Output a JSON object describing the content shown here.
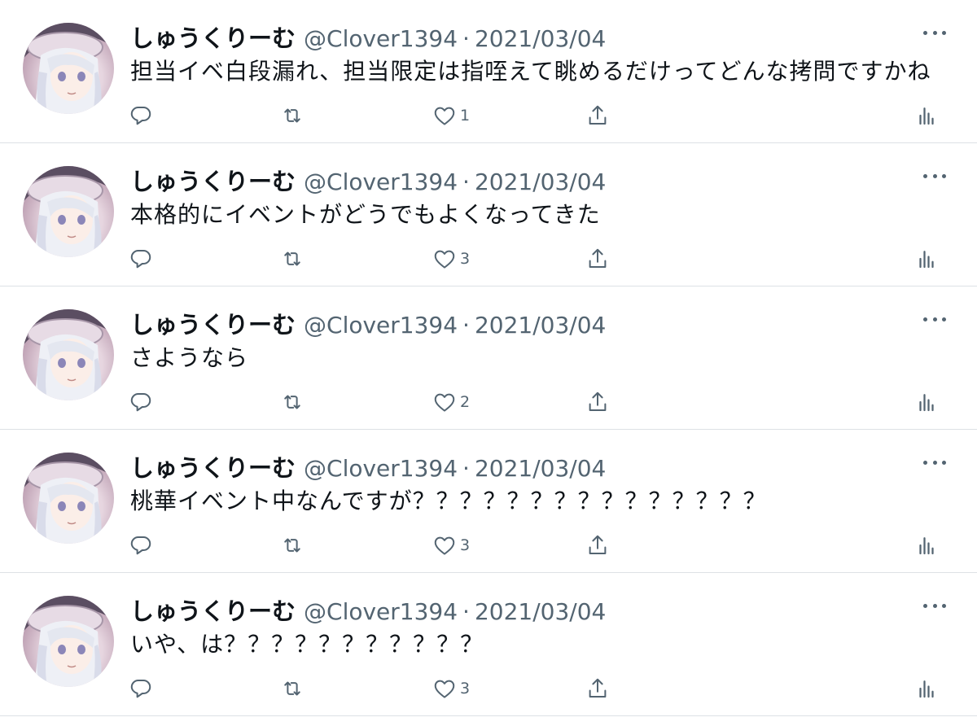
{
  "tweets": [
    {
      "name": "しゅうくりーむ",
      "handle": "@Clover1394",
      "separator": "·",
      "date": "2021/03/04",
      "text": "担当イベ白段漏れ、担当限定は指咥えて眺めるだけってどんな拷問ですかね",
      "likes": "1"
    },
    {
      "name": "しゅうくりーむ",
      "handle": "@Clover1394",
      "separator": "·",
      "date": "2021/03/04",
      "text": "本格的にイベントがどうでもよくなってきた",
      "likes": "3"
    },
    {
      "name": "しゅうくりーむ",
      "handle": "@Clover1394",
      "separator": "·",
      "date": "2021/03/04",
      "text": "さようなら",
      "likes": "2"
    },
    {
      "name": "しゅうくりーむ",
      "handle": "@Clover1394",
      "separator": "·",
      "date": "2021/03/04",
      "text": "桃華イベント中なんですが？？？？？？？？？？？？？？？",
      "likes": "3"
    },
    {
      "name": "しゅうくりーむ",
      "handle": "@Clover1394",
      "separator": "·",
      "date": "2021/03/04",
      "text": "いや、は？？？？？？？？？？？",
      "likes": "3"
    }
  ],
  "icons": {
    "reply": "reply-icon",
    "retweet": "retweet-icon",
    "like": "heart-icon",
    "share": "share-icon",
    "stats": "analytics-icon",
    "more": "more-icon"
  },
  "colors": {
    "text_primary": "#0f1419",
    "text_secondary": "#536471",
    "divider": "#dde1e5"
  }
}
